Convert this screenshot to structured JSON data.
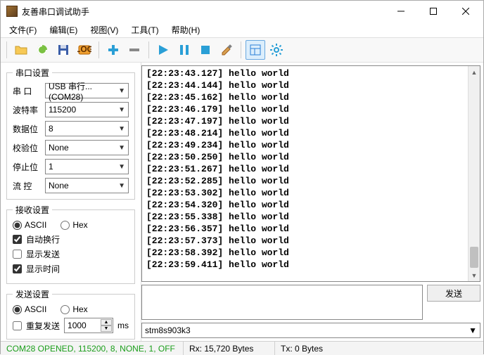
{
  "window": {
    "title": "友善串口调试助手"
  },
  "menu": {
    "file": "文件(F)",
    "edit": "编辑(E)",
    "view": "视图(V)",
    "tools": "工具(T)",
    "help": "帮助(H)"
  },
  "serial_settings": {
    "legend": "串口设置",
    "port_label": "串  口",
    "port_value": "USB 串行...(COM28)",
    "baud_label": "波特率",
    "baud_value": "115200",
    "databits_label": "数据位",
    "databits_value": "8",
    "parity_label": "校验位",
    "parity_value": "None",
    "stopbits_label": "停止位",
    "stopbits_value": "1",
    "flow_label": "流  控",
    "flow_value": "None"
  },
  "recv_settings": {
    "legend": "接收设置",
    "ascii": "ASCII",
    "hex": "Hex",
    "autowrap": "自动换行",
    "showsend": "显示发送",
    "showtime": "显示时间"
  },
  "send_settings": {
    "legend": "发送设置",
    "ascii": "ASCII",
    "hex": "Hex",
    "repeat": "重复发送",
    "interval": "1000",
    "unit": "ms"
  },
  "log_lines": [
    "[22:23:43.127] hello world",
    "[22:23:44.144] hello world",
    "[22:23:45.162] hello world",
    "[22:23:46.179] hello world",
    "[22:23:47.197] hello world",
    "[22:23:48.214] hello world",
    "[22:23:49.234] hello world",
    "[22:23:50.250] hello world",
    "[22:23:51.267] hello world",
    "[22:23:52.285] hello world",
    "[22:23:53.302] hello world",
    "[22:23:54.320] hello world",
    "[22:23:55.338] hello world",
    "[22:23:56.357] hello world",
    "[22:23:57.373] hello world",
    "[22:23:58.392] hello world",
    "[22:23:59.411] hello world"
  ],
  "send": {
    "button": "发送",
    "target": "stm8s903k3"
  },
  "status": {
    "conn": "COM28 OPENED, 115200, 8, NONE, 1, OFF",
    "rx": "Rx: 15,720 Bytes",
    "tx": "Tx: 0 Bytes"
  }
}
